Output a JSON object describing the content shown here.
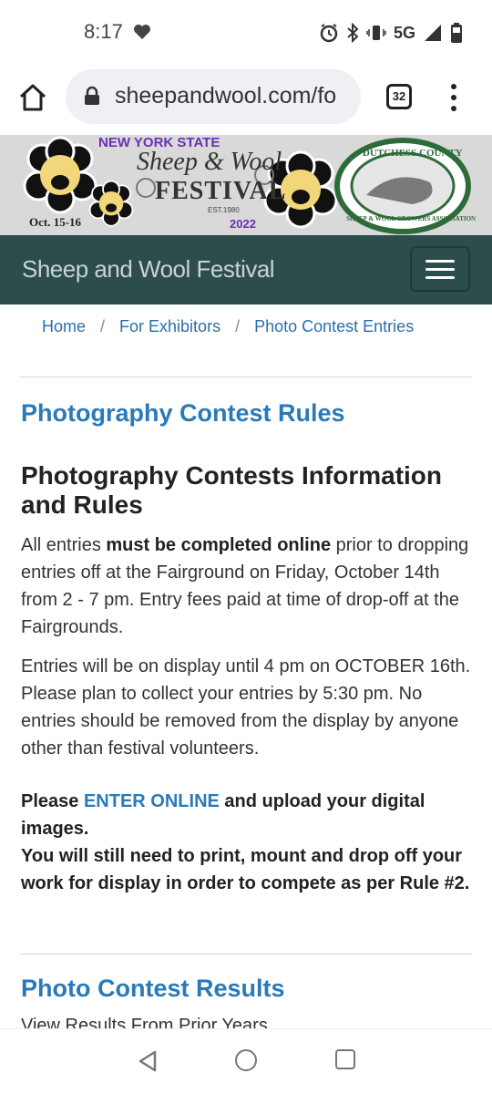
{
  "status_bar": {
    "time": "8:17",
    "network": "5G",
    "icons": [
      "heart-icon",
      "alarm-icon",
      "bluetooth-icon",
      "vibrate-icon",
      "signal-icon",
      "battery-icon"
    ]
  },
  "browser": {
    "url": "sheepandwool.com/fo",
    "tab_count": "32"
  },
  "banner": {
    "state": "NEW YORK STATE",
    "title_line1": "Sheep & Wool",
    "title_line2": "FESTIVAL",
    "est": "EST.1980",
    "year": "2022",
    "dates": "Oct. 15-16",
    "assoc_top": "DUTCHESS COUNTY",
    "assoc_bottom": "SHEEP & WOOL GROWERS ASSOCIATION"
  },
  "navbar": {
    "brand": "Sheep and Wool Festival"
  },
  "breadcrumb": {
    "items": [
      "Home",
      "For Exhibitors",
      "Photo Contest Entries"
    ]
  },
  "main": {
    "section_title": "Photography Contest Rules",
    "heading": "Photography Contests Information and Rules",
    "p1_pre": "All entries ",
    "p1_bold": "must be completed online",
    "p1_post": " prior to dropping entries off at the Fairground on Friday, October 14th from 2 - 7 pm. Entry fees paid at time of drop-off at the Fairgrounds.",
    "p2": "Entries will be on display until 4 pm on OCTOBER 16th. Please plan to collect your entries by 5:30 pm. No entries should be removed from the display by anyone other than festival volunteers.",
    "p3_pre": "Please ",
    "p3_link": "ENTER ONLINE",
    "p3_post": " and upload your digital images.",
    "p4": "You will still need to print, mount and drop off your work for display in order to compete as per Rule #2.",
    "results_title": "Photo Contest Results",
    "results_sub": "View Results From Prior Years"
  },
  "colors": {
    "navbar": "#2c4d4c",
    "link": "#2b7ab8",
    "banner_purple": "#6a2fb5",
    "assoc_green": "#2e6b3a"
  }
}
